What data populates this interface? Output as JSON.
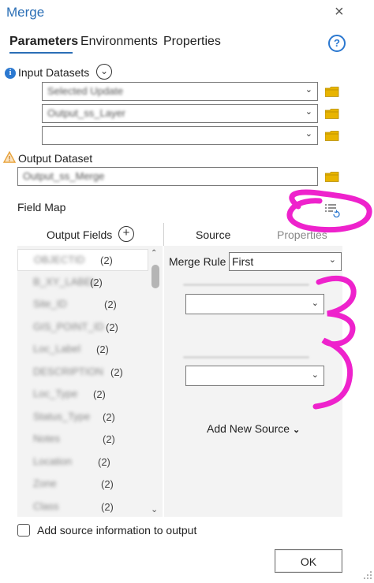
{
  "window": {
    "title": "Merge",
    "close_glyph": "×"
  },
  "tabs": [
    {
      "label": "Parameters",
      "active": true
    },
    {
      "label": "Environments",
      "active": false
    },
    {
      "label": "Properties",
      "active": false
    }
  ],
  "help_glyph": "?",
  "input_datasets": {
    "label": "Input Datasets",
    "info_glyph": "i",
    "expand_glyph": "⌄",
    "rows": [
      {
        "value": "Selected Update"
      },
      {
        "value": "Output_ss_Layer"
      },
      {
        "value": ""
      }
    ]
  },
  "output_dataset": {
    "label": "Output Dataset",
    "warning_glyph": "!",
    "value": "Output_ss_Merge"
  },
  "field_map": {
    "label": "Field Map",
    "output_fields_label": "Output Fields",
    "add_glyph": "+",
    "tabs": [
      {
        "label": "Source",
        "active": true
      },
      {
        "label": "Properties",
        "active": false
      }
    ],
    "merge_rule_label": "Merge Rule",
    "merge_rule_value": "First",
    "add_new_source_label": "Add New Source",
    "add_new_source_chevron": "⌄",
    "fields": [
      {
        "name": "OBJECTID",
        "count": "(2)"
      },
      {
        "name": "B_XY_LABEL",
        "count": "(2)"
      },
      {
        "name": "Site_ID",
        "count": "(2)"
      },
      {
        "name": "GIS_POINT_ID",
        "count": "(2)"
      },
      {
        "name": "Loc_Label",
        "count": "(2)"
      },
      {
        "name": "DESCRIPTION",
        "count": "(2)"
      },
      {
        "name": "Loc_Type",
        "count": "(2)"
      },
      {
        "name": "Status_Type",
        "count": "(2)"
      },
      {
        "name": "Notes",
        "count": "(2)"
      },
      {
        "name": "Location",
        "count": "(2)"
      },
      {
        "name": "Zone",
        "count": "(2)"
      },
      {
        "name": "Class",
        "count": "(2)"
      }
    ]
  },
  "footer": {
    "checkbox_label": "Add source information to output",
    "ok_label": "OK"
  },
  "colors": {
    "accent": "#2b6fb6",
    "folder": "#e8b400",
    "warning": "#e8a33c",
    "annotation": "#ee22cc"
  },
  "icons": [
    "close-icon",
    "help-icon",
    "info-icon",
    "expand-icon",
    "folder-icon",
    "warning-icon",
    "field-map-reset-icon",
    "add-field-icon",
    "chevron-down-icon"
  ]
}
